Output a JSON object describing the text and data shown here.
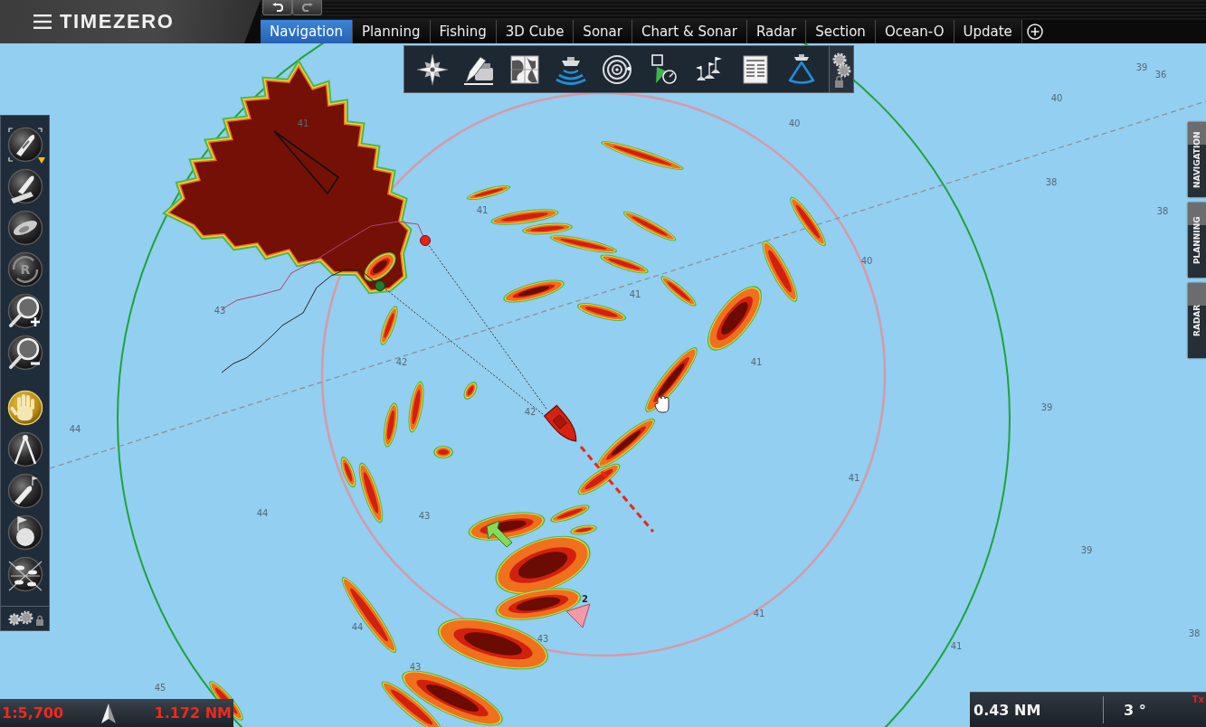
{
  "header": {
    "logo": "TIMEZERO"
  },
  "tabs": [
    {
      "label": "Navigation",
      "selected": true
    },
    {
      "label": "Planning",
      "selected": false
    },
    {
      "label": "Fishing",
      "selected": false
    },
    {
      "label": "3D Cube",
      "selected": false
    },
    {
      "label": "Sonar",
      "selected": false
    },
    {
      "label": "Chart & Sonar",
      "selected": false
    },
    {
      "label": "Radar",
      "selected": false
    },
    {
      "label": "Section",
      "selected": false
    },
    {
      "label": "Ocean-O",
      "selected": false
    },
    {
      "label": "Update",
      "selected": false
    }
  ],
  "left_tools": [
    {
      "selected": false
    },
    {
      "selected": false
    },
    {
      "selected": false
    },
    {
      "selected": false,
      "label": "R"
    },
    {
      "selected": false
    },
    {
      "selected": false
    },
    {
      "selected": true
    },
    {
      "selected": false
    },
    {
      "selected": false
    },
    {
      "selected": false
    },
    {
      "selected": false
    }
  ],
  "side_tabs": [
    {
      "label": "NAVIGATION"
    },
    {
      "label": "PLANNING"
    },
    {
      "label": "RADAR"
    }
  ],
  "chart": {
    "soundings": [
      "39",
      "36",
      "40",
      "41",
      "40",
      "38",
      "41",
      "38",
      "40",
      "41",
      "43",
      "42",
      "41",
      "39",
      "42",
      "44",
      "41",
      "44",
      "43",
      "39",
      "41",
      "44",
      "38",
      "43",
      "41",
      "43",
      "45"
    ],
    "waypoint_label": "2"
  },
  "scale_bar": {
    "scale": "1:5,700",
    "distance": "1.172 NM"
  },
  "radar_status": {
    "range": "0.43 NM",
    "bearing": "3 °",
    "tx": "Tx"
  }
}
